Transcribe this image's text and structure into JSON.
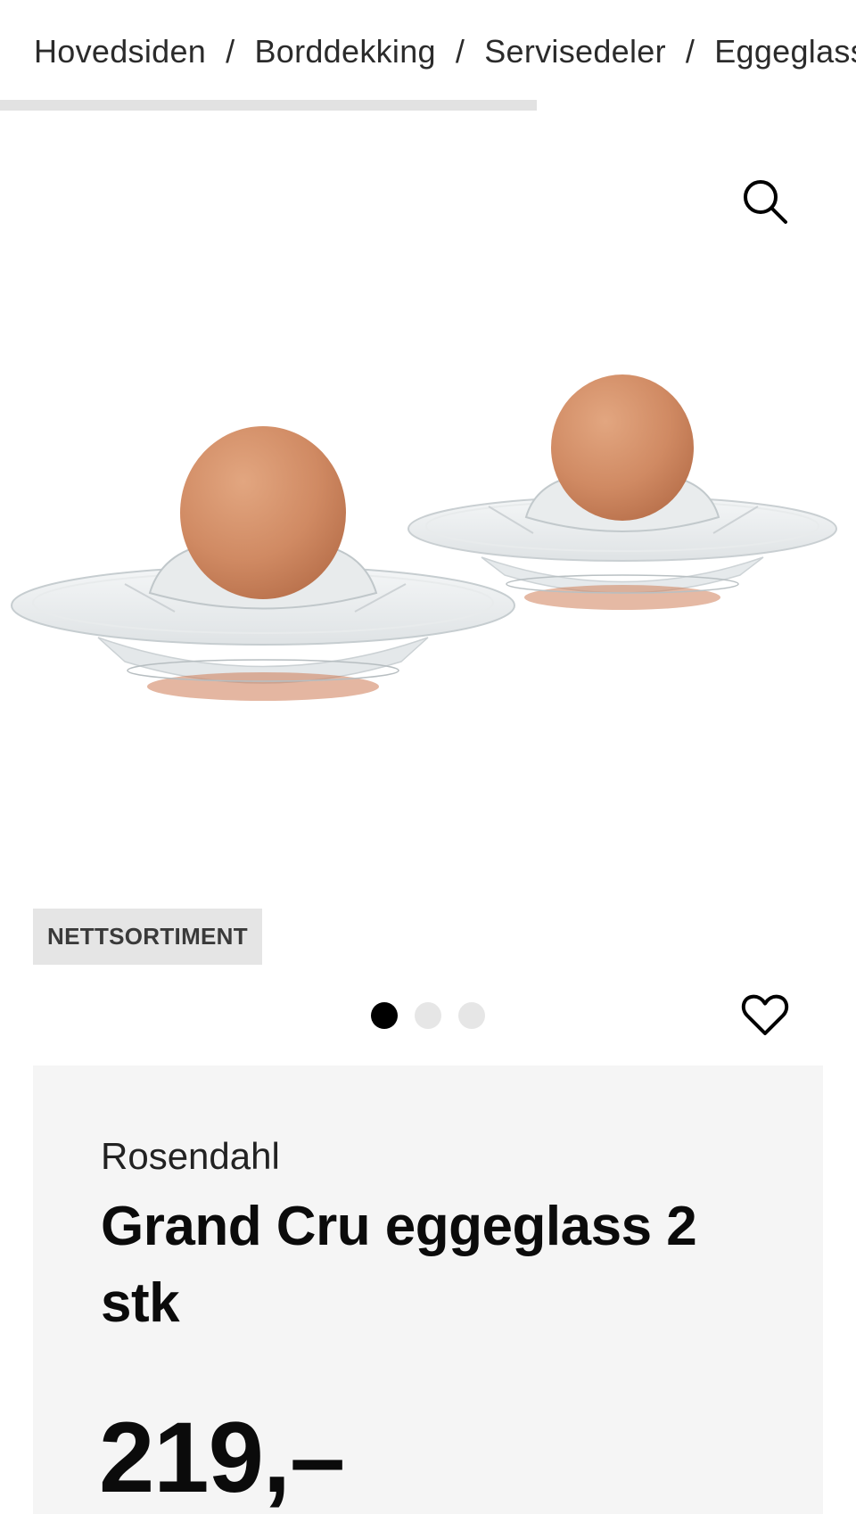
{
  "breadcrumb": {
    "items": [
      "Hovedsiden",
      "Borddekking",
      "Servisedeler",
      "Eggeglass"
    ],
    "separator": "/"
  },
  "gallery": {
    "zoom_icon": "search-icon",
    "badge": "NETTSORTIMENT",
    "slide_count": 3,
    "active_slide": 1,
    "favorite_icon": "heart-icon"
  },
  "product": {
    "brand": "Rosendahl",
    "title": "Grand Cru eggeglass 2 stk",
    "price": "219,–"
  }
}
